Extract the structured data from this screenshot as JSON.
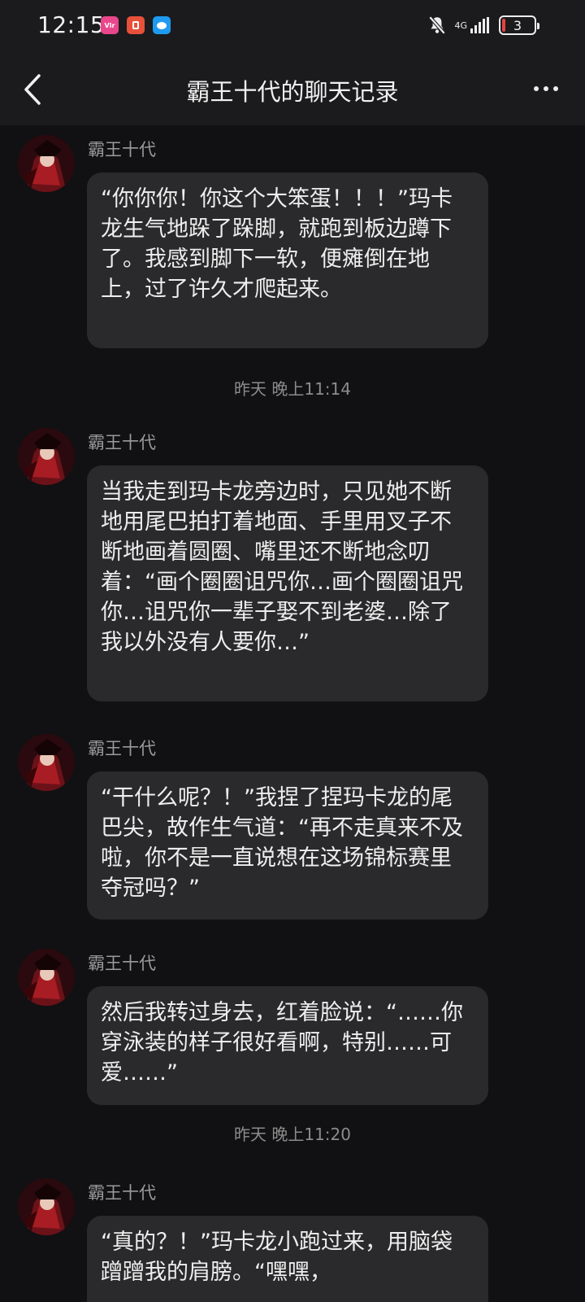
{
  "status_bar": {
    "time": "12:15",
    "network_label": "4G",
    "battery_level": "3",
    "notification_icons": [
      "pink-app-icon",
      "red-app-icon",
      "chat-app-icon"
    ],
    "battery_color": "#e84343"
  },
  "header": {
    "title": "霸王十代的聊天记录",
    "back_icon": "chevron-left-icon",
    "more_icon": "more-dots-icon"
  },
  "messages": [
    {
      "sender": "霸王十代",
      "text": "“你你你！你这个大笨蛋！！！”玛卡龙生气地跺了跺脚，就跑到板边蹲下了。我感到脚下一软，便瘫倒在地上，过了许久才爬起来。"
    },
    {
      "sender": "霸王十代",
      "text": "当我走到玛卡龙旁边时，只见她不断地用尾巴拍打着地面、手里用叉子不断地画着圆圈、嘴里还不断地念叨着：“画个圈圈诅咒你…画个圈圈诅咒你…诅咒你一辈子娶不到老婆…除了我以外没有人要你…”"
    },
    {
      "sender": "霸王十代",
      "text": "“干什么呢？！”我捏了捏玛卡龙的尾巴尖，故作生气道：“再不走真来不及啦，你不是一直说想在这场锦标赛里夺冠吗？”"
    },
    {
      "sender": "霸王十代",
      "text": "然后我转过身去，红着脸说：“……你穿泳装的样子很好看啊，特别……可爱……”"
    },
    {
      "sender": "霸王十代",
      "text": "“真的？！”玛卡龙小跑过来，用脑袋蹭蹭我的肩膀。“嘿嘿，"
    }
  ],
  "time_separators": [
    "昨天 晚上11:14",
    "昨天 晚上11:20"
  ]
}
